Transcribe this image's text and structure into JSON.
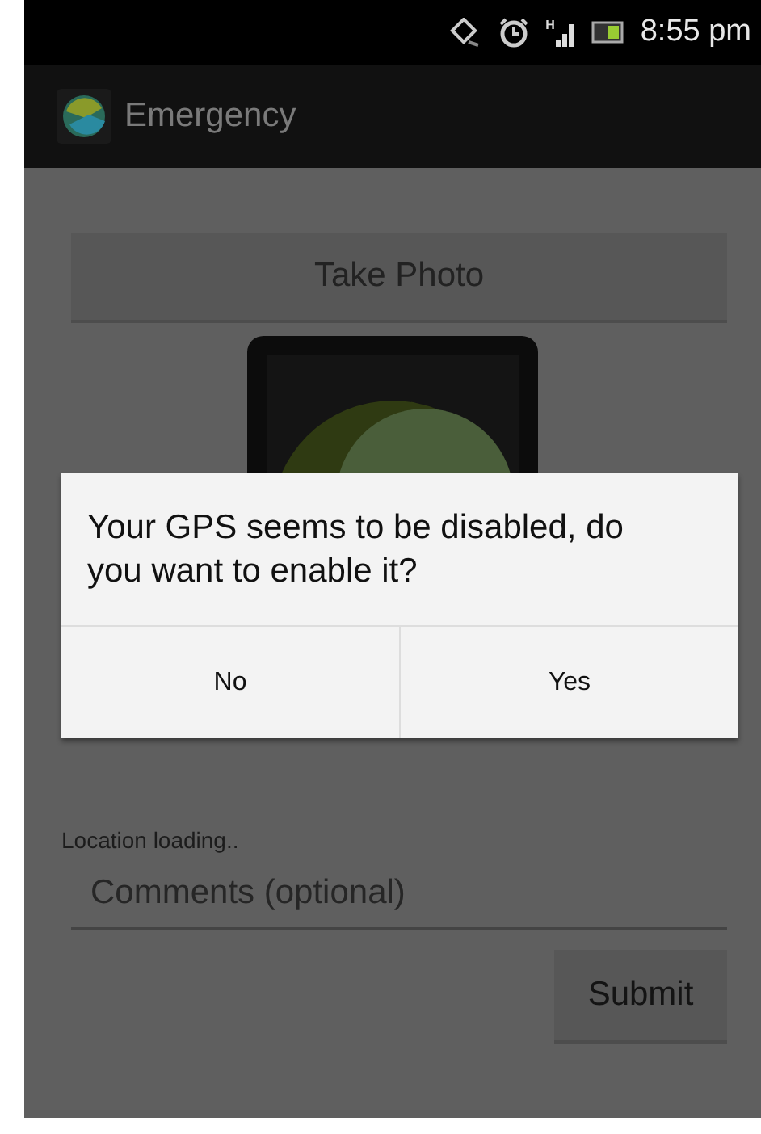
{
  "status_bar": {
    "network_type": "H",
    "time": "8:55 pm"
  },
  "action_bar": {
    "title": "Emergency"
  },
  "take_photo_button": {
    "label": "Take Photo"
  },
  "location_status": "Location loading..",
  "comments_field": {
    "placeholder": "Comments (optional)"
  },
  "submit_button": {
    "label": "Submit"
  },
  "dialog": {
    "message": "Your GPS seems to be disabled, do you want to enable it?",
    "buttons": [
      "No",
      "Yes"
    ]
  }
}
